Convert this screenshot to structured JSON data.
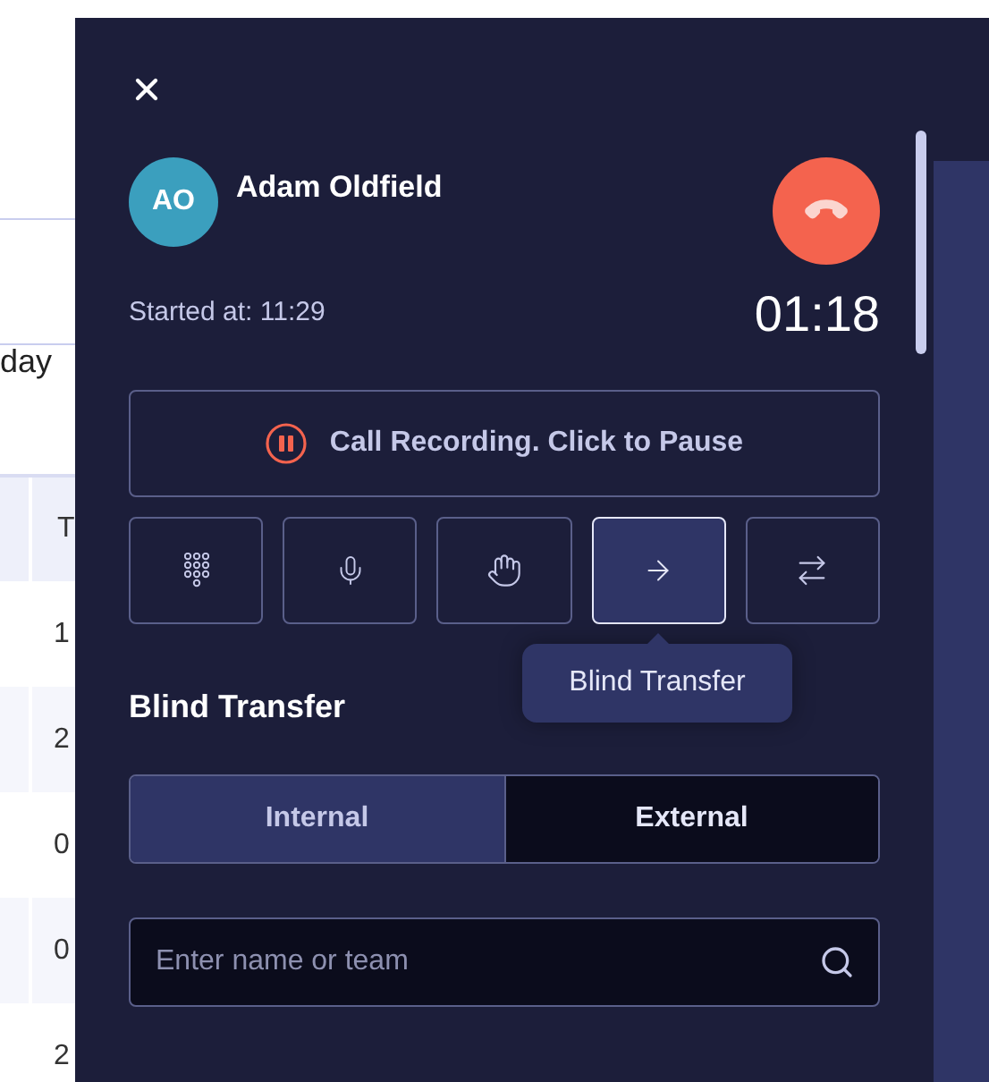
{
  "background_page": {
    "heading": "day",
    "table": {
      "header": "T",
      "cells": [
        "1",
        "2",
        "0",
        "0",
        "2"
      ]
    }
  },
  "call_panel": {
    "caller": {
      "initials": "AO",
      "name": "Adam Oldfield"
    },
    "started": "Started at: 11:29",
    "timer": "01:18",
    "recording": {
      "label": "Call Recording. Click to Pause"
    },
    "actions": [
      {
        "kind": "dialpad",
        "selected": false
      },
      {
        "kind": "mute",
        "selected": false
      },
      {
        "kind": "hold",
        "selected": false
      },
      {
        "kind": "blind_transfer",
        "selected": true
      },
      {
        "kind": "transfer",
        "selected": false
      }
    ],
    "tooltip": "Blind Transfer",
    "section_title": "Blind Transfer",
    "transfer_tabs": [
      {
        "label": "Internal",
        "selected": true
      },
      {
        "label": "External",
        "selected": false
      }
    ],
    "search": {
      "placeholder": "Enter name or team"
    }
  }
}
